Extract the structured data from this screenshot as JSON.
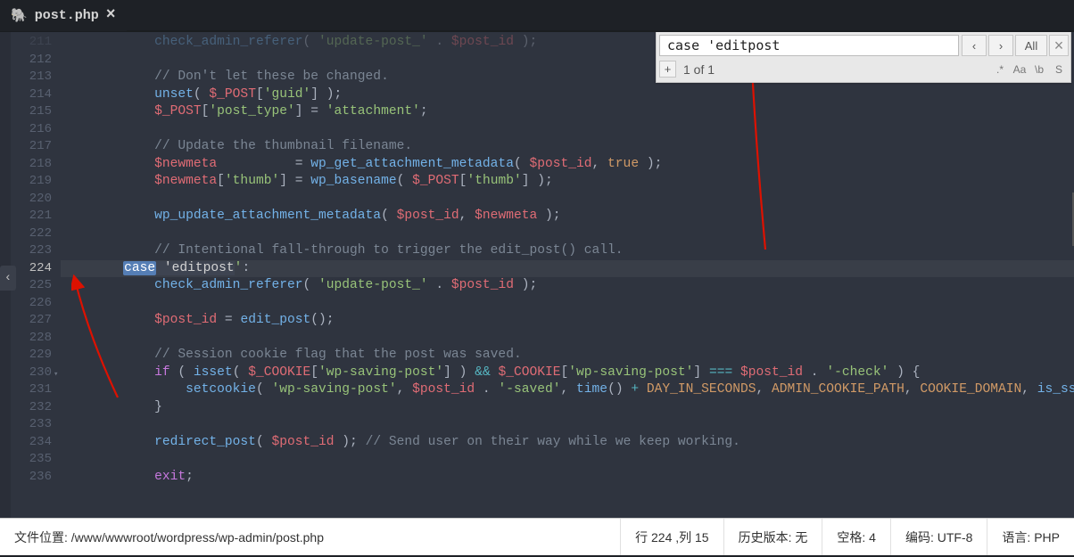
{
  "tab": {
    "filename": "post.php",
    "icon": "🐘"
  },
  "find": {
    "query": "case 'editpost",
    "prev_icon": "‹",
    "next_icon": "›",
    "all_label": "All",
    "close_icon": "×",
    "add_icon": "+",
    "count_text": "1 of 1",
    "opts": {
      "regex": ".*",
      "case": "Aa",
      "word": "\\b",
      "sel": "S"
    }
  },
  "sidebar_toggle_icon": "‹",
  "gutter": {
    "first_line": 211,
    "last_line": 236,
    "active_line": 224,
    "fold_line": 230
  },
  "code": [
    {
      "ln": 211,
      "indent": 3,
      "truncated_top": true,
      "tokens": [
        [
          "func",
          "check_admin_referer"
        ],
        [
          "plain",
          "( "
        ],
        [
          "str",
          "'update-post_'"
        ],
        [
          "plain",
          " . "
        ],
        [
          "var",
          "$post_id"
        ],
        [
          "plain",
          " );"
        ]
      ]
    },
    {
      "ln": 212,
      "indent": 0,
      "tokens": []
    },
    {
      "ln": 213,
      "indent": 3,
      "tokens": [
        [
          "comment",
          "// Don't let these be changed."
        ]
      ]
    },
    {
      "ln": 214,
      "indent": 3,
      "tokens": [
        [
          "func",
          "unset"
        ],
        [
          "plain",
          "( "
        ],
        [
          "var",
          "$_POST"
        ],
        [
          "plain",
          "["
        ],
        [
          "str",
          "'guid'"
        ],
        [
          "plain",
          "] );"
        ]
      ]
    },
    {
      "ln": 215,
      "indent": 3,
      "tokens": [
        [
          "var",
          "$_POST"
        ],
        [
          "plain",
          "["
        ],
        [
          "str",
          "'post_type'"
        ],
        [
          "plain",
          "] = "
        ],
        [
          "str",
          "'attachment'"
        ],
        [
          "plain",
          ";"
        ]
      ]
    },
    {
      "ln": 216,
      "indent": 0,
      "tokens": []
    },
    {
      "ln": 217,
      "indent": 3,
      "tokens": [
        [
          "comment",
          "// Update the thumbnail filename."
        ]
      ]
    },
    {
      "ln": 218,
      "indent": 3,
      "tokens": [
        [
          "var",
          "$newmeta"
        ],
        [
          "plain",
          "          = "
        ],
        [
          "func",
          "wp_get_attachment_metadata"
        ],
        [
          "plain",
          "( "
        ],
        [
          "var",
          "$post_id"
        ],
        [
          "plain",
          ", "
        ],
        [
          "bool",
          "true"
        ],
        [
          "plain",
          " );"
        ]
      ]
    },
    {
      "ln": 219,
      "indent": 3,
      "tokens": [
        [
          "var",
          "$newmeta"
        ],
        [
          "plain",
          "["
        ],
        [
          "str",
          "'thumb'"
        ],
        [
          "plain",
          "] = "
        ],
        [
          "func",
          "wp_basename"
        ],
        [
          "plain",
          "( "
        ],
        [
          "var",
          "$_POST"
        ],
        [
          "plain",
          "["
        ],
        [
          "str",
          "'thumb'"
        ],
        [
          "plain",
          "] );"
        ]
      ]
    },
    {
      "ln": 220,
      "indent": 0,
      "tokens": []
    },
    {
      "ln": 221,
      "indent": 3,
      "tokens": [
        [
          "func",
          "wp_update_attachment_metadata"
        ],
        [
          "plain",
          "( "
        ],
        [
          "var",
          "$post_id"
        ],
        [
          "plain",
          ", "
        ],
        [
          "var",
          "$newmeta"
        ],
        [
          "plain",
          " );"
        ]
      ]
    },
    {
      "ln": 222,
      "indent": 0,
      "tokens": []
    },
    {
      "ln": 223,
      "indent": 3,
      "tokens": [
        [
          "comment",
          "// Intentional fall-through to trigger the edit_post() call."
        ]
      ]
    },
    {
      "ln": 224,
      "indent": 2,
      "active": true,
      "tokens": [
        [
          "hl-sel",
          "case"
        ],
        [
          "hl",
          " 'editpost"
        ],
        [
          "str",
          "'"
        ],
        [
          "plain",
          ":"
        ]
      ]
    },
    {
      "ln": 225,
      "indent": 3,
      "tokens": [
        [
          "func",
          "check_admin_referer"
        ],
        [
          "plain",
          "( "
        ],
        [
          "str",
          "'update-post_'"
        ],
        [
          "plain",
          " . "
        ],
        [
          "var",
          "$post_id"
        ],
        [
          "plain",
          " );"
        ]
      ]
    },
    {
      "ln": 226,
      "indent": 0,
      "tokens": []
    },
    {
      "ln": 227,
      "indent": 3,
      "tokens": [
        [
          "var",
          "$post_id"
        ],
        [
          "plain",
          " = "
        ],
        [
          "func",
          "edit_post"
        ],
        [
          "plain",
          "();"
        ]
      ]
    },
    {
      "ln": 228,
      "indent": 0,
      "tokens": []
    },
    {
      "ln": 229,
      "indent": 3,
      "tokens": [
        [
          "comment",
          "// Session cookie flag that the post was saved."
        ]
      ]
    },
    {
      "ln": 230,
      "indent": 3,
      "tokens": [
        [
          "kw",
          "if"
        ],
        [
          "plain",
          " ( "
        ],
        [
          "func",
          "isset"
        ],
        [
          "plain",
          "( "
        ],
        [
          "var",
          "$_COOKIE"
        ],
        [
          "plain",
          "["
        ],
        [
          "str",
          "'wp-saving-post'"
        ],
        [
          "plain",
          "] ) "
        ],
        [
          "op",
          "&&"
        ],
        [
          "plain",
          " "
        ],
        [
          "var",
          "$_COOKIE"
        ],
        [
          "plain",
          "["
        ],
        [
          "str",
          "'wp-saving-post'"
        ],
        [
          "plain",
          "] "
        ],
        [
          "op",
          "==="
        ],
        [
          "plain",
          " "
        ],
        [
          "var",
          "$post_id"
        ],
        [
          "plain",
          " . "
        ],
        [
          "str",
          "'-check'"
        ],
        [
          "plain",
          " ) {"
        ]
      ]
    },
    {
      "ln": 231,
      "indent": 4,
      "tokens": [
        [
          "func",
          "setcookie"
        ],
        [
          "plain",
          "( "
        ],
        [
          "str",
          "'wp-saving-post'"
        ],
        [
          "plain",
          ", "
        ],
        [
          "var",
          "$post_id"
        ],
        [
          "plain",
          " . "
        ],
        [
          "str",
          "'-saved'"
        ],
        [
          "plain",
          ", "
        ],
        [
          "func",
          "time"
        ],
        [
          "plain",
          "() "
        ],
        [
          "op",
          "+"
        ],
        [
          "plain",
          " "
        ],
        [
          "const",
          "DAY_IN_SECONDS"
        ],
        [
          "plain",
          ", "
        ],
        [
          "const",
          "ADMIN_COOKIE_PATH"
        ],
        [
          "plain",
          ", "
        ],
        [
          "const",
          "COOKIE_DOMAIN"
        ],
        [
          "plain",
          ", "
        ],
        [
          "func",
          "is_ssl"
        ],
        [
          "plain",
          "() );"
        ]
      ]
    },
    {
      "ln": 232,
      "indent": 3,
      "tokens": [
        [
          "plain",
          "}"
        ]
      ]
    },
    {
      "ln": 233,
      "indent": 0,
      "tokens": []
    },
    {
      "ln": 234,
      "indent": 3,
      "tokens": [
        [
          "func",
          "redirect_post"
        ],
        [
          "plain",
          "( "
        ],
        [
          "var",
          "$post_id"
        ],
        [
          "plain",
          " ); "
        ],
        [
          "comment",
          "// Send user on their way while we keep working."
        ]
      ]
    },
    {
      "ln": 235,
      "indent": 0,
      "tokens": []
    },
    {
      "ln": 236,
      "indent": 3,
      "tokens": [
        [
          "kw",
          "exit"
        ],
        [
          "plain",
          ";"
        ]
      ]
    }
  ],
  "statusbar": {
    "path_label": "文件位置:",
    "path_value": "/www/wwwroot/wordpress/wp-admin/post.php",
    "row_col": "行 224 ,列 15",
    "history_label": "历史版本:",
    "history_value": "无",
    "spaces_label": "空格:",
    "spaces_value": "4",
    "encoding_label": "编码:",
    "encoding_value": "UTF-8",
    "lang_label": "语言:",
    "lang_value": "PHP"
  }
}
